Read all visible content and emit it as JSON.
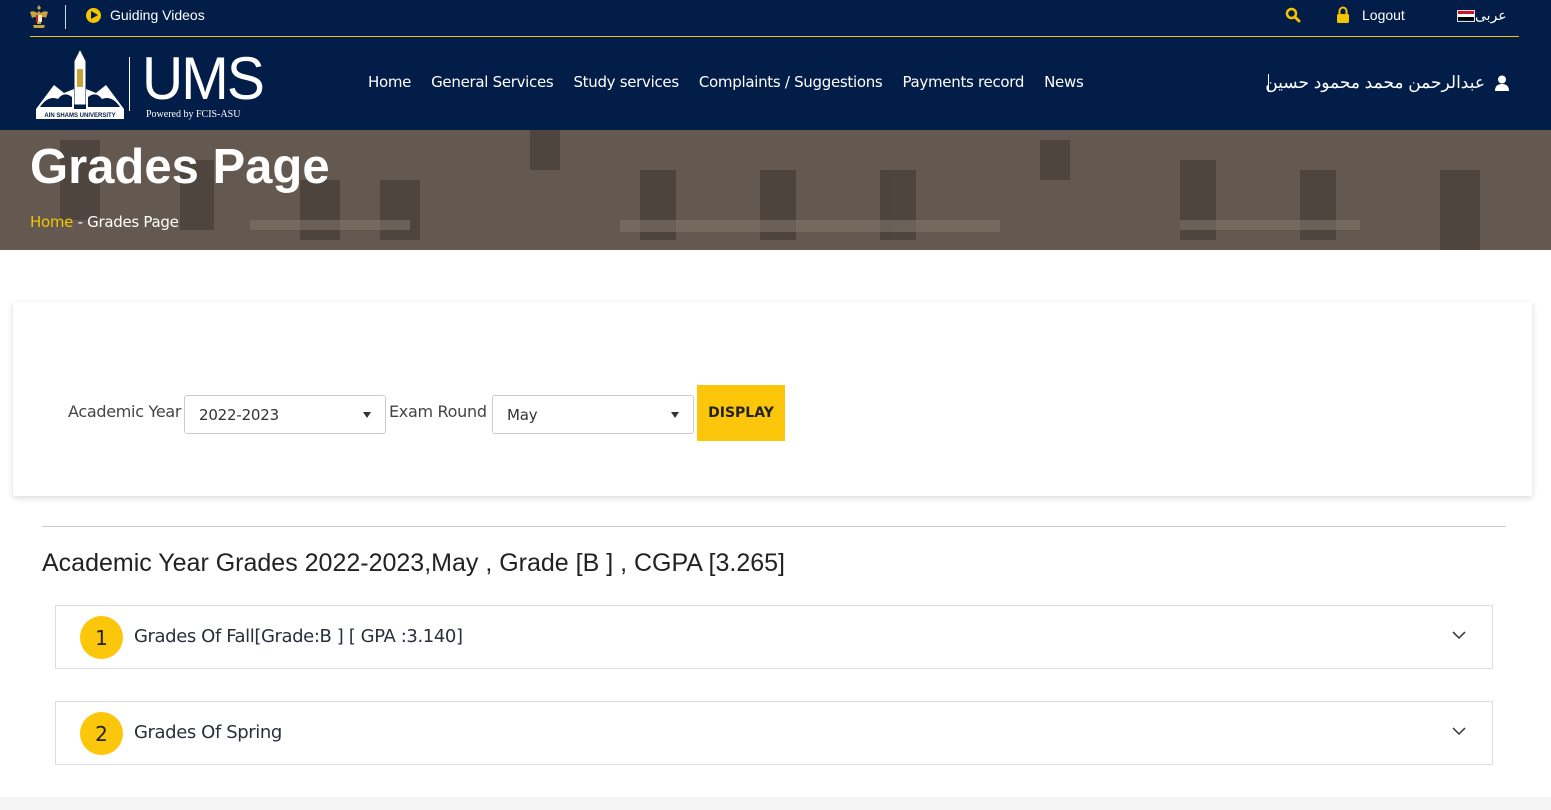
{
  "topbar": {
    "guiding_label": "Guiding Videos",
    "logout_label": "Logout",
    "lang_label": "عربى"
  },
  "header": {
    "logo_brand": "UMS",
    "logo_sub": "Powered by FCIS-ASU",
    "nav": [
      "Home",
      "General Services",
      "Study services",
      "Complaints / Suggestions",
      "Payments record",
      "News"
    ],
    "user_name": "عبدالرحمن محمد محمود حسين"
  },
  "banner": {
    "title": "Grades Page",
    "breadcrumb_home": "Home",
    "breadcrumb_sep": " - ",
    "breadcrumb_current": "Grades Page"
  },
  "filters": {
    "year_label": "Academic Year :",
    "year_value": "2022-2023",
    "round_label": "Exam Round :",
    "round_value": "May",
    "display_label": "DISPLAY"
  },
  "summary": "Academic Year Grades 2022-2023,May , Grade [B ] , CGPA [3.265]",
  "semesters": [
    {
      "number": "1",
      "title": "Grades Of Fall[Grade:B ] [ GPA :3.140]"
    },
    {
      "number": "2",
      "title": "Grades Of Spring"
    }
  ],
  "colors": {
    "navy": "#021d47",
    "accent": "#fcc70a"
  },
  "icons": [
    "egypt-eagle-icon",
    "play-icon",
    "search-icon",
    "lock-icon",
    "egypt-flag-icon",
    "user-icon",
    "caret-down-icon",
    "chevron-down-icon"
  ]
}
